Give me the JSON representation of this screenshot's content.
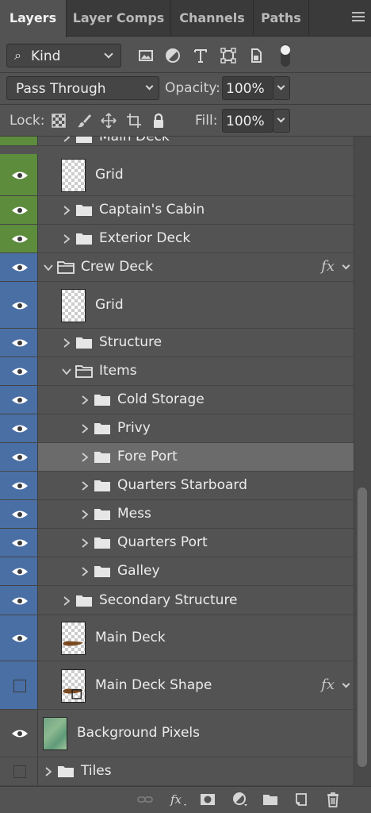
{
  "tabs": [
    {
      "label": "Layers",
      "active": true
    },
    {
      "label": "Layer Comps",
      "active": false
    },
    {
      "label": "Channels",
      "active": false
    },
    {
      "label": "Paths",
      "active": false
    }
  ],
  "filter": {
    "kind_label": "Kind",
    "icons": [
      "pixel-filter-icon",
      "adjustment-filter-icon",
      "type-filter-icon",
      "shape-filter-icon",
      "smart-object-filter-icon",
      "filter-toggle"
    ]
  },
  "blend": {
    "mode": "Pass Through",
    "opacity_label": "Opacity:",
    "opacity": "100%"
  },
  "lock": {
    "label": "Lock:",
    "fill_label": "Fill:",
    "fill": "100%",
    "icons": [
      "lock-transparent-icon",
      "lock-brush-icon",
      "lock-move-icon",
      "lock-artboard-icon",
      "lock-all-icon"
    ]
  },
  "colors": {
    "green": "#5d8c3d",
    "blue": "#4a6fa5",
    "selected": "#6b6b6b"
  },
  "layers": [
    {
      "name": "Main Deck",
      "kind": "group",
      "color": "green",
      "partial": true
    },
    {
      "name": "Grid",
      "kind": "layer",
      "color": "green"
    },
    {
      "name": "Captain's Cabin",
      "kind": "group",
      "color": "green"
    },
    {
      "name": "Exterior Deck",
      "kind": "group",
      "color": "green"
    },
    {
      "name": "Crew Deck",
      "kind": "group",
      "color": "blue",
      "open": true,
      "fx": true
    },
    {
      "name": "Grid",
      "kind": "layer",
      "color": "blue"
    },
    {
      "name": "Structure",
      "kind": "group",
      "color": "blue"
    },
    {
      "name": "Items",
      "kind": "group",
      "color": "blue",
      "open": true
    },
    {
      "name": "Cold Storage",
      "kind": "group",
      "color": "blue"
    },
    {
      "name": "Privy",
      "kind": "group",
      "color": "blue"
    },
    {
      "name": "Fore Port",
      "kind": "group",
      "color": "blue",
      "selected": true
    },
    {
      "name": "Quarters Starboard",
      "kind": "group",
      "color": "blue"
    },
    {
      "name": "Mess",
      "kind": "group",
      "color": "blue"
    },
    {
      "name": "Quarters Port",
      "kind": "group",
      "color": "blue"
    },
    {
      "name": "Galley",
      "kind": "group",
      "color": "blue"
    },
    {
      "name": "Secondary Structure",
      "kind": "group",
      "color": "blue"
    },
    {
      "name": "Main Deck",
      "kind": "layer",
      "color": "blue"
    },
    {
      "name": "Main Deck Shape",
      "kind": "shape",
      "color": "blue",
      "hidden": true,
      "fx": true
    },
    {
      "name": "Background Pixels",
      "kind": "layer",
      "color": "none"
    },
    {
      "name": "Tiles",
      "kind": "group",
      "color": "none",
      "hidden": true
    }
  ],
  "fx_label": "fx",
  "bottom_icons": [
    "link-layers-icon",
    "add-style-icon",
    "add-mask-icon",
    "new-adjustment-icon",
    "new-group-icon",
    "new-layer-icon",
    "delete-layer-icon"
  ]
}
